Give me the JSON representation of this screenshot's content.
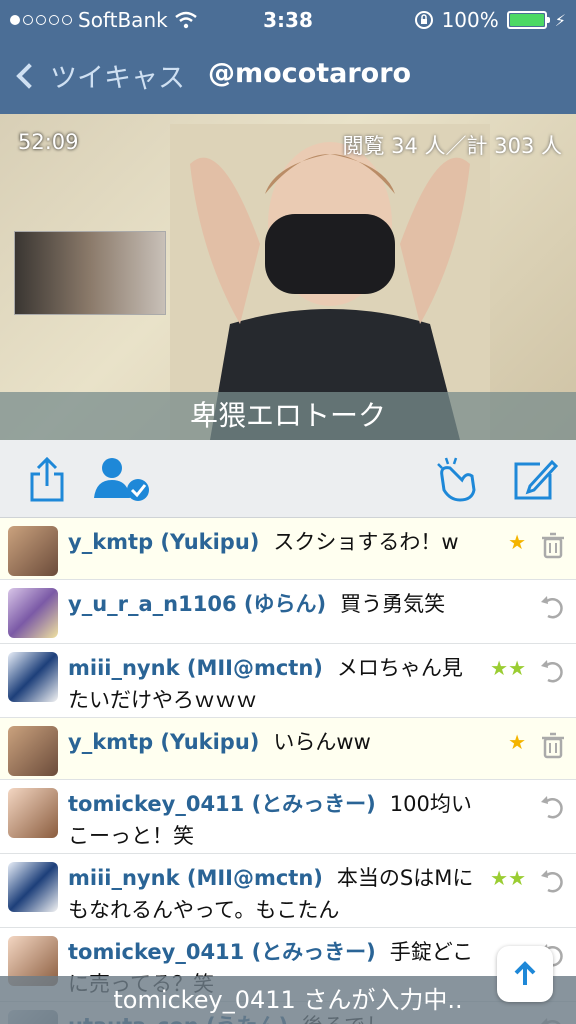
{
  "status_bar": {
    "carrier": "SoftBank",
    "time": "3:38",
    "battery": "100%",
    "battery_level": 1.0
  },
  "nav": {
    "back_label": "ツイキャス",
    "title": "@mocotaroro"
  },
  "video": {
    "timer": "52:09",
    "viewers": "閲覧 34 人／計 303 人",
    "caption": "卑猥エロトーク"
  },
  "toolbar": {
    "icons": [
      "share-icon",
      "follow-icon",
      "clap-icon",
      "compose-icon"
    ]
  },
  "comments": [
    {
      "user": "y_kmtp (Yukipu)",
      "text": "スクショするわ！w",
      "stars": "★",
      "action": "trash"
    },
    {
      "user": "y_u_r_a_n1106 (ゆらん)",
      "text": "買う勇気笑",
      "stars": "",
      "action": "reply"
    },
    {
      "user": "miii_nynk (MII@mctn)",
      "text": "メロちゃん見たいだけやろｗｗｗ",
      "stars": "★★",
      "action": "reply"
    },
    {
      "user": "y_kmtp (Yukipu)",
      "text": "いらんww",
      "stars": "★",
      "action": "trash"
    },
    {
      "user": "tomickey_0411 (とみっきー)",
      "text": "100均いこーっと！笑",
      "stars": "",
      "action": "reply"
    },
    {
      "user": "miii_nynk (MII@mctn)",
      "text": "本当のSはMにもなれるんやって。もこたん",
      "stars": "★★",
      "action": "reply"
    },
    {
      "user": "tomickey_0411 (とみっきー)",
      "text": "手錠どこに売ってる？笑",
      "stars": "",
      "action": "reply"
    },
    {
      "user": "utauta_con (うたん)",
      "text": "後るでし",
      "stars": "",
      "action": "reply"
    }
  ],
  "typing_indicator": "tomickey_0411 さんが入力中..",
  "colors": {
    "nav": "#4b6e96",
    "username": "#2a6496",
    "accent": "#1e88d8"
  }
}
